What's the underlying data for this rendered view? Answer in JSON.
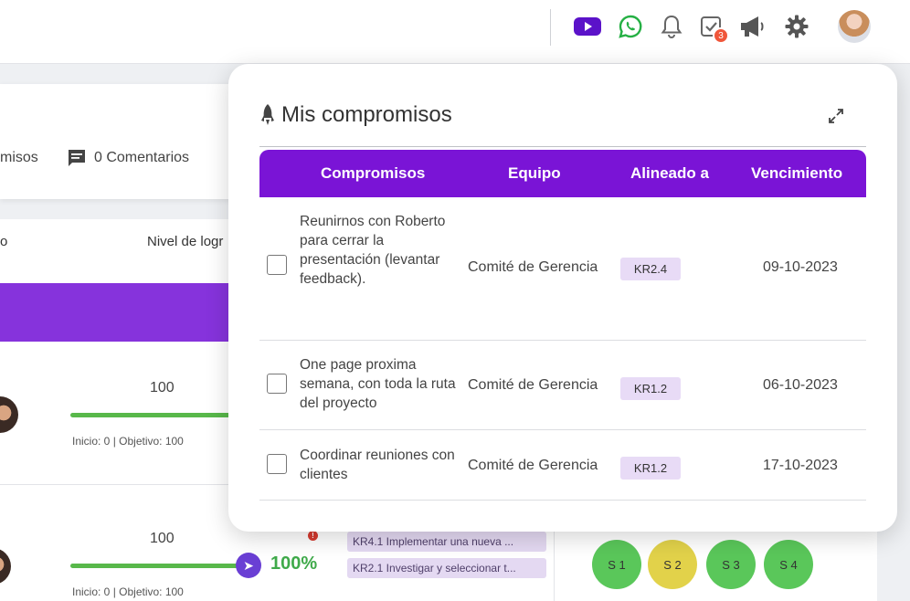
{
  "topbar": {
    "icons": [
      "youtube-icon",
      "whatsapp-icon",
      "bell-icon",
      "task-check-icon",
      "megaphone-icon",
      "gear-icon"
    ],
    "tasks_badge": "3",
    "colors": {
      "youtube": "#5b12c9",
      "whatsapp": "#25b044",
      "icon_gray": "#666666",
      "badge": "#f0563a"
    }
  },
  "background": {
    "tab_commitments_partial": "misos",
    "comments_label": "0 Comentarios",
    "column_partial": "o",
    "column_level_partial": "Nivel de logr",
    "rows": [
      {
        "value": "100",
        "range": "Inicio: 0 | Objetivo: 100"
      },
      {
        "value": "100",
        "range": "Inicio: 0 | Objetivo: 100",
        "percent": "100%"
      }
    ],
    "alert_mark": "!",
    "kr_tags": [
      "KR4.1 Implementar una nueva ...",
      "KR2.1 Investigar y seleccionar t..."
    ],
    "sprints": [
      {
        "label": "S 1",
        "color": "#5ac75a"
      },
      {
        "label": "S 2",
        "color": "#e2d24a"
      },
      {
        "label": "S 3",
        "color": "#5ac75a"
      },
      {
        "label": "S 4",
        "color": "#5ac75a"
      }
    ]
  },
  "modal": {
    "title": "Mis compromisos",
    "header_color": "#7a14d6",
    "columns": [
      "Compromisos",
      "Equipo",
      "Alineado a",
      "Vencimiento"
    ],
    "rows": [
      {
        "text": "Reunirnos con Roberto para cerrar la presentación (levantar feedback).",
        "team": "Comité de Gerencia",
        "kr": "KR2.4",
        "due": "09-10-2023"
      },
      {
        "text": "One page proxima semana, con toda la ruta del proyecto",
        "team": "Comité de Gerencia",
        "kr": "KR1.2",
        "due": "06-10-2023"
      },
      {
        "text": "Coordinar reuniones con clientes",
        "team": "Comité de Gerencia",
        "kr": "KR1.2",
        "due": "17-10-2023"
      }
    ]
  }
}
